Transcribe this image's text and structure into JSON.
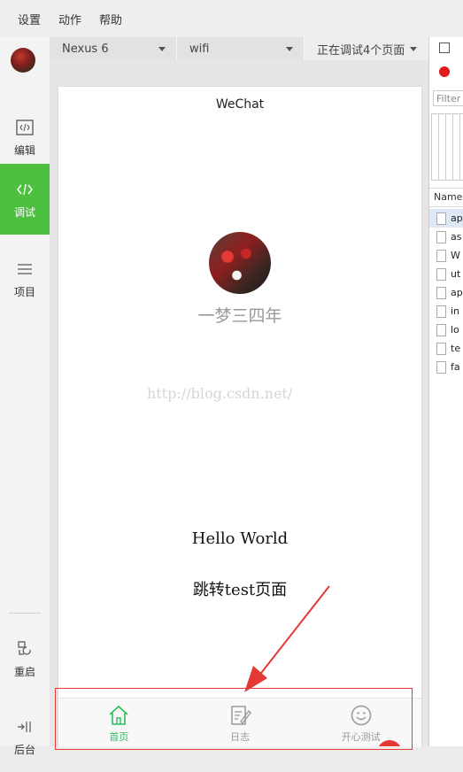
{
  "menu": {
    "items": [
      "设置",
      "动作",
      "帮助"
    ]
  },
  "sidebar": {
    "items": [
      {
        "label": "编辑",
        "icon": "code-icon"
      },
      {
        "label": "调试",
        "icon": "code-icon"
      },
      {
        "label": "项目",
        "icon": "menu-icon"
      },
      {
        "label": "重启",
        "icon": "restart-icon"
      },
      {
        "label": "后台",
        "icon": "background-icon"
      }
    ]
  },
  "device": {
    "model": "Nexus 6",
    "network": "wifi",
    "debug_status": "正在调试4个页面"
  },
  "simulator": {
    "title": "WeChat",
    "nickname": "一梦三四年",
    "watermark": "http://blog.csdn.net/",
    "hello": "Hello World",
    "jump_link": "跳转test页面",
    "tabs": [
      {
        "label": "首页",
        "icon": "home-icon",
        "active": true
      },
      {
        "label": "日志",
        "icon": "log-icon",
        "active": false
      },
      {
        "label": "开心测试",
        "icon": "smile-icon",
        "active": false
      }
    ]
  },
  "network_panel": {
    "filter_placeholder": "Filter",
    "column_name": "Name",
    "requests": [
      "ap",
      "as",
      "W",
      "ut",
      "ap",
      "in",
      "lo",
      "te",
      "fa"
    ]
  },
  "colors": {
    "active_green": "#4cbf3f",
    "tab_active": "#2bbf5a",
    "record_red": "#e01b1b",
    "highlight_red": "#e53935"
  }
}
